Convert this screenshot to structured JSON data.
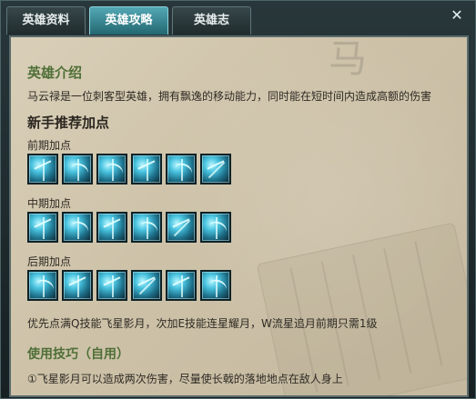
{
  "tabs": [
    {
      "label": "英雄资料"
    },
    {
      "label": "英雄攻略"
    },
    {
      "label": "英雄志"
    }
  ],
  "close_label": "✕",
  "hero": {
    "section_title": "英雄介绍",
    "description": "马云禄是一位刺客型英雄，拥有飘逸的移动能力，同时能在短时间内造成高额的伤害"
  },
  "recommend": {
    "title": "新手推荐加点",
    "stages": [
      {
        "label": "前期加点"
      },
      {
        "label": "中期加点"
      },
      {
        "label": "后期加点"
      }
    ]
  },
  "note": "优先点满Q技能飞星影月，次加E技能连星耀月，W流星追月前期只需1级",
  "tips": {
    "title": "使用技巧（自用）",
    "items": [
      "①飞星影月可以造成两次伤害，尽量使长戟的落地地点在敌人身上"
    ]
  },
  "watermark_text": "马"
}
